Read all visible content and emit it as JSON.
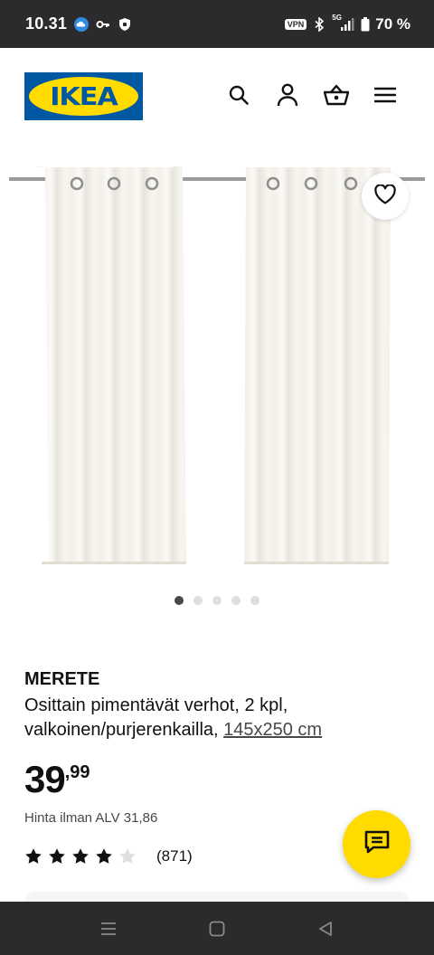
{
  "status_bar": {
    "time": "10.31",
    "vpn": "VPN",
    "network": "5G",
    "battery": "70 %"
  },
  "header": {
    "logo_text": "IKEA",
    "icons": [
      "search-icon",
      "account-icon",
      "basket-icon",
      "menu-icon"
    ]
  },
  "carousel": {
    "total_images": 5,
    "active_index": 0
  },
  "product": {
    "name": "MERETE",
    "description": "Osittain pimentävät verhot, 2 kpl, valkoinen/purjerenkailla,",
    "size_link": "145x250 cm",
    "price_int": "39",
    "price_dec": ",99",
    "vat_text": "Hinta ilman ALV 31,86",
    "rating": 4,
    "rating_max": 5,
    "rating_count": "(871)"
  },
  "colors": {
    "ikea_blue": "#0058a3",
    "ikea_yellow": "#ffdb00",
    "system_bar": "#2b2b2e"
  }
}
